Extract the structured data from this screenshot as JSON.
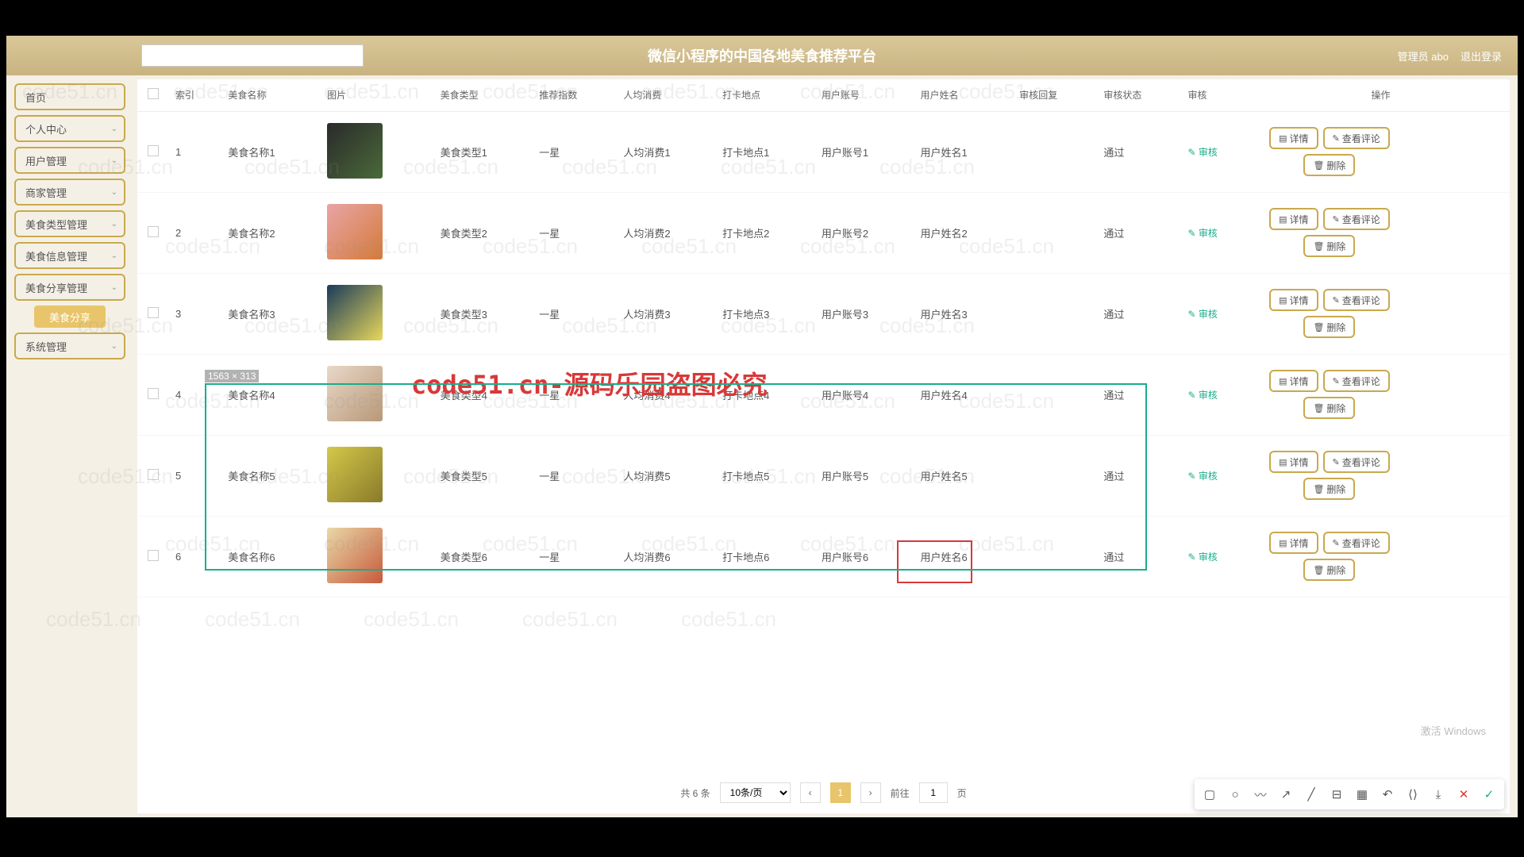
{
  "header": {
    "title": "微信小程序的中国各地美食推荐平台",
    "user_label": "管理员 abo",
    "logout": "退出登录"
  },
  "sidebar": {
    "items": [
      {
        "label": "首页",
        "expandable": false
      },
      {
        "label": "个人中心",
        "expandable": true
      },
      {
        "label": "用户管理",
        "expandable": true
      },
      {
        "label": "商家管理",
        "expandable": true
      },
      {
        "label": "美食类型管理",
        "expandable": true
      },
      {
        "label": "美食信息管理",
        "expandable": true
      },
      {
        "label": "美食分享管理",
        "expandable": true
      },
      {
        "label": "美食分享",
        "sub": true
      },
      {
        "label": "系统管理",
        "expandable": true
      }
    ]
  },
  "table": {
    "headers": [
      "",
      "索引",
      "美食名称",
      "图片",
      "美食类型",
      "推荐指数",
      "人均消费",
      "打卡地点",
      "用户账号",
      "用户姓名",
      "审核回复",
      "审核状态",
      "审核",
      "操作"
    ],
    "rows": [
      {
        "idx": "1",
        "name": "美食名称1",
        "type": "美食类型1",
        "rating": "一星",
        "cost": "人均消费1",
        "place": "打卡地点1",
        "account": "用户账号1",
        "username": "用户姓名1",
        "reply": "",
        "status": "通过",
        "audit": "✎ 审核"
      },
      {
        "idx": "2",
        "name": "美食名称2",
        "type": "美食类型2",
        "rating": "一星",
        "cost": "人均消费2",
        "place": "打卡地点2",
        "account": "用户账号2",
        "username": "用户姓名2",
        "reply": "",
        "status": "通过",
        "audit": "✎ 审核"
      },
      {
        "idx": "3",
        "name": "美食名称3",
        "type": "美食类型3",
        "rating": "一星",
        "cost": "人均消费3",
        "place": "打卡地点3",
        "account": "用户账号3",
        "username": "用户姓名3",
        "reply": "",
        "status": "通过",
        "audit": "✎ 审核"
      },
      {
        "idx": "4",
        "name": "美食名称4",
        "type": "美食类型4",
        "rating": "一星",
        "cost": "人均消费4",
        "place": "打卡地点4",
        "account": "用户账号4",
        "username": "用户姓名4",
        "reply": "",
        "status": "通过",
        "audit": "✎ 审核"
      },
      {
        "idx": "5",
        "name": "美食名称5",
        "type": "美食类型5",
        "rating": "一星",
        "cost": "人均消费5",
        "place": "打卡地点5",
        "account": "用户账号5",
        "username": "用户姓名5",
        "reply": "",
        "status": "通过",
        "audit": "✎ 审核"
      },
      {
        "idx": "6",
        "name": "美食名称6",
        "type": "美食类型6",
        "rating": "一星",
        "cost": "人均消费6",
        "place": "打卡地点6",
        "account": "用户账号6",
        "username": "用户姓名6",
        "reply": "",
        "status": "通过",
        "audit": "✎ 审核"
      }
    ]
  },
  "actions": {
    "detail": "详情",
    "comments": "查看评论",
    "delete": "删除"
  },
  "pagination": {
    "total": "共 6 条",
    "per_page": "10条/页",
    "current": "1",
    "goto_prefix": "前往",
    "goto_value": "1",
    "goto_suffix": "页"
  },
  "overlay": {
    "selection_size": "1563 × 313",
    "center_watermark": "code51.cn-源码乐园盗图必究",
    "bg_watermark": "code51.cn",
    "activate": "激活 Windows"
  }
}
